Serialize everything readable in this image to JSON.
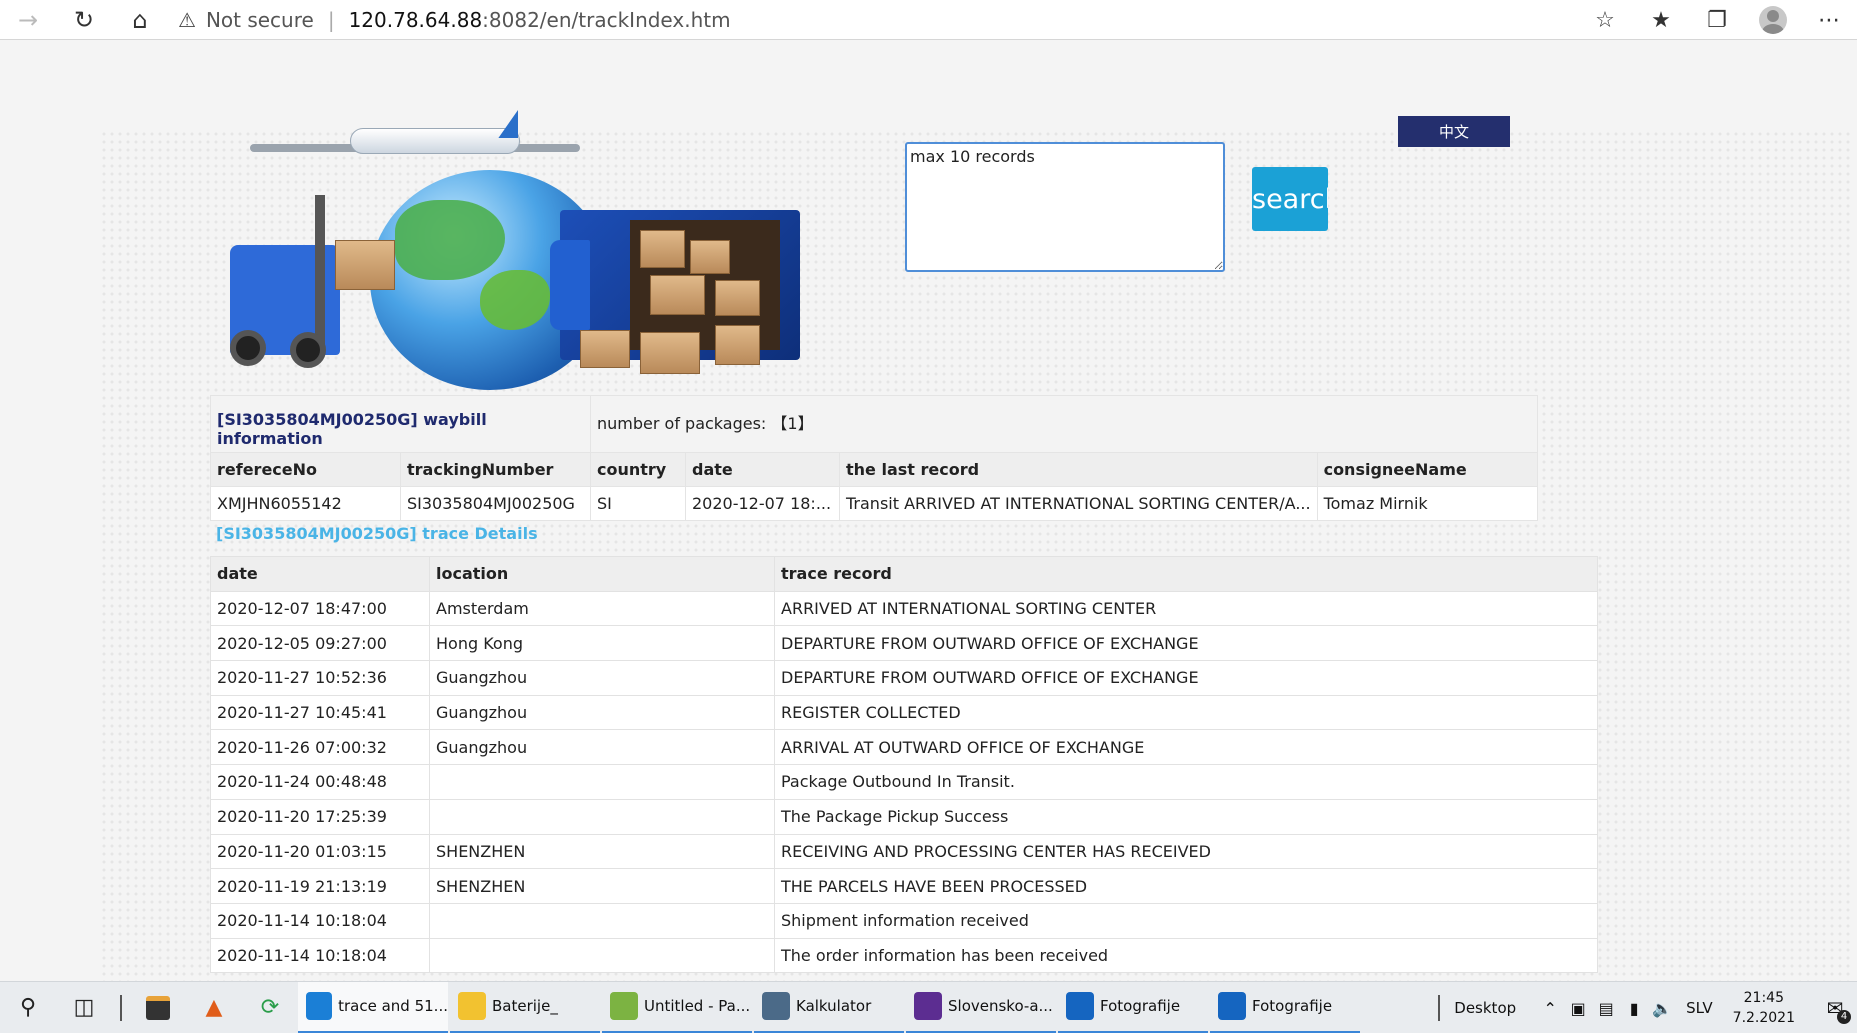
{
  "browser": {
    "not_secure": "Not secure",
    "url_host": "120.78.64.88",
    "url_rest": ":8082/en/trackIndex.htm"
  },
  "search": {
    "placeholder": "max 10 records",
    "button_label": "search",
    "lang_label": "中文"
  },
  "waybill": {
    "title": "[SI3035804MJ00250G] waybill information",
    "packages_label": "number of packages:",
    "packages_value": "【1】",
    "headers": [
      "refereceNo",
      "trackingNumber",
      "country",
      "date",
      "the last record",
      "consigneeName"
    ],
    "row": [
      "XMJHN6055142",
      "SI3035804MJ00250G",
      "SI",
      "2020-12-07 18:...",
      "Transit ARRIVED AT INTERNATIONAL SORTING CENTER/A...",
      "Tomaz Mirnik"
    ]
  },
  "trace": {
    "title": "[SI3035804MJ00250G] trace Details",
    "headers": [
      "date",
      "location",
      "trace record"
    ],
    "rows": [
      [
        "2020-12-07 18:47:00",
        "Amsterdam",
        "ARRIVED AT INTERNATIONAL SORTING CENTER"
      ],
      [
        "2020-12-05 09:27:00",
        "Hong Kong",
        "DEPARTURE FROM OUTWARD OFFICE OF EXCHANGE"
      ],
      [
        "2020-11-27 10:52:36",
        "Guangzhou",
        "DEPARTURE FROM OUTWARD OFFICE OF EXCHANGE"
      ],
      [
        "2020-11-27 10:45:41",
        "Guangzhou",
        "REGISTER COLLECTED"
      ],
      [
        "2020-11-26 07:00:32",
        "Guangzhou",
        "ARRIVAL AT OUTWARD OFFICE OF EXCHANGE"
      ],
      [
        "2020-11-24 00:48:48",
        "",
        "Package Outbound In Transit."
      ],
      [
        "2020-11-20 17:25:39",
        "",
        "The Package Pickup Success"
      ],
      [
        "2020-11-20 01:03:15",
        "SHENZHEN",
        "RECEIVING AND PROCESSING CENTER HAS RECEIVED"
      ],
      [
        "2020-11-19 21:13:19",
        "SHENZHEN",
        "THE PARCELS HAVE BEEN PROCESSED"
      ],
      [
        "2020-11-14 10:18:04",
        "",
        "Shipment information received"
      ],
      [
        "2020-11-14 10:18:04",
        "",
        "The order information has been received"
      ]
    ]
  },
  "taskbar": {
    "apps": [
      {
        "label": "trace and 51...",
        "icon": "edge-icon",
        "color": "#1b7fd6"
      },
      {
        "label": "Baterije_",
        "icon": "folder-icon",
        "color": "#f2c230"
      },
      {
        "label": "Untitled - Pa...",
        "icon": "paint-icon",
        "color": "#7cb342"
      },
      {
        "label": "Kalkulator",
        "icon": "calculator-icon",
        "color": "#4b6a88"
      },
      {
        "label": "Slovensko-a...",
        "icon": "dictionary-icon",
        "color": "#5c2d91"
      },
      {
        "label": "Fotografije",
        "icon": "photos-icon",
        "color": "#1565c0"
      },
      {
        "label": "Fotografije",
        "icon": "photos-icon",
        "color": "#1565c0"
      }
    ],
    "desktop_label": "Desktop",
    "language": "SLV",
    "time": "21:45",
    "date": "7.2.2021",
    "notification_count": "4"
  }
}
